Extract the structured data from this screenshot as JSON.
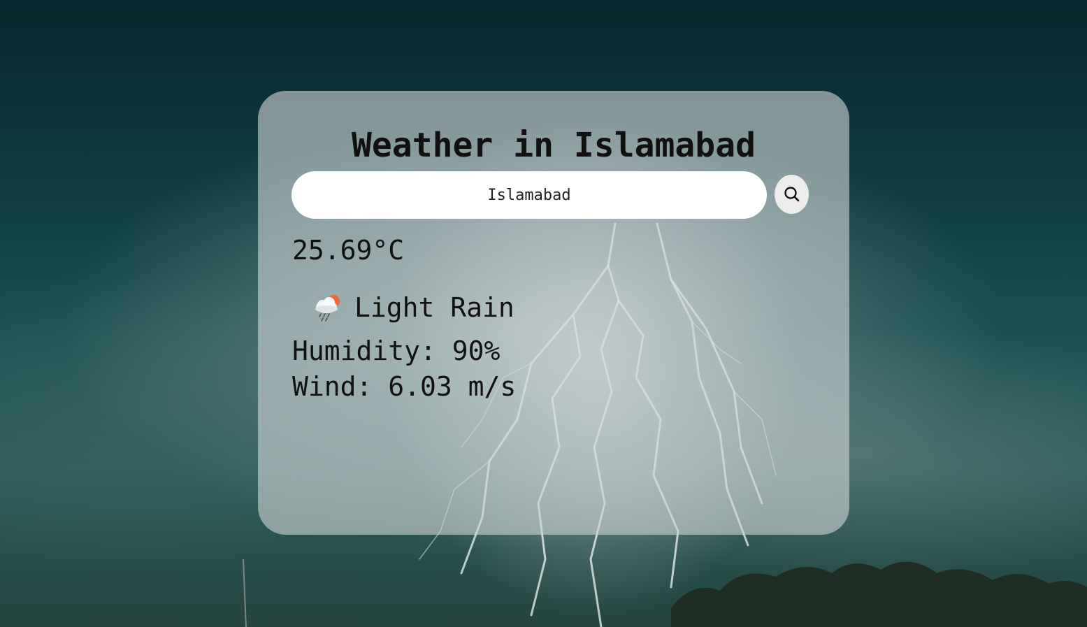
{
  "weather": {
    "title": "Weather in Islamabad",
    "search": {
      "value": "Islamabad",
      "placeholder": "Search"
    },
    "search_button_icon": "search-icon",
    "temperature": "25.69°C",
    "condition": {
      "icon": "cloud-rain-sun-icon",
      "text": "Light Rain"
    },
    "humidity": "Humidity: 90%",
    "wind": "Wind: 6.03 m/s"
  },
  "colors": {
    "card_background": "#cdd2d4",
    "input_background": "#ffffff",
    "button_background": "#ececec",
    "text": "#111111",
    "sun_accent": "#f06a3c"
  }
}
